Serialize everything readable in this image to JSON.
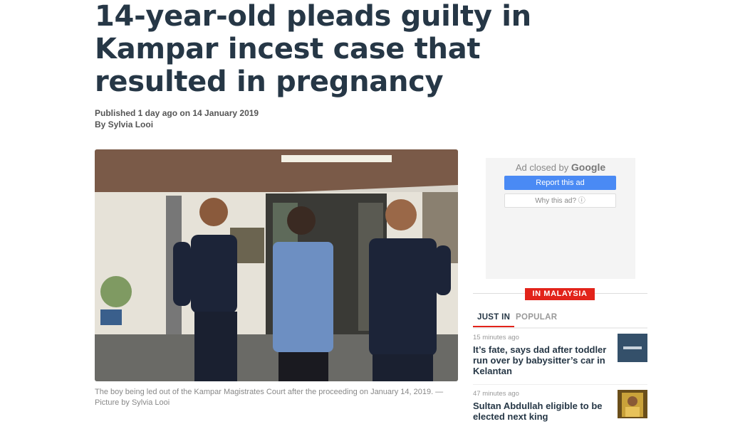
{
  "article": {
    "headline": "14-year-old pleads guilty in Kampar incest case that resulted in pregnancy",
    "published": "Published 1 day ago on 14 January 2019",
    "byline": "By Sylvia Looi",
    "caption": "The boy being led out of the Kampar Magistrates Court after the proceeding on January 14, 2019. — Picture by Sylvia Looi"
  },
  "ad": {
    "closed_prefix": "Ad closed by",
    "closed_brand": "Google",
    "report_label": "Report this ad",
    "why_label": "Why this ad? ⓘ"
  },
  "sidebar": {
    "section_badge": "IN MALAYSIA",
    "tabs": [
      "JUST IN",
      "POPULAR"
    ],
    "items": [
      {
        "time": "15 minutes ago",
        "title": "It’s fate, says dad after toddler run over by babysitter’s car in Kelantan"
      },
      {
        "time": "47 minutes ago",
        "title": "Sultan Abdullah eligible to be elected next king"
      }
    ]
  },
  "colors": {
    "headline": "#263746",
    "accent_red": "#e2231a",
    "google_blue": "#4a8af4"
  }
}
